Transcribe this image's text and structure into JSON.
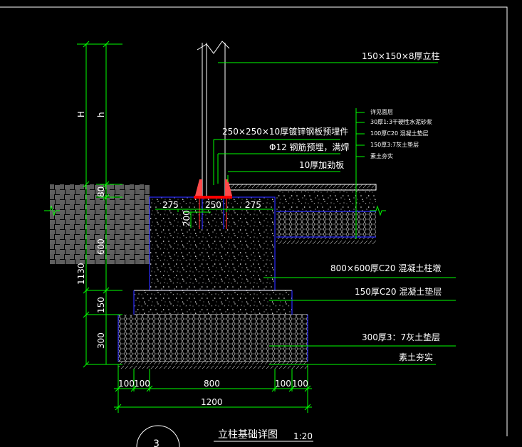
{
  "drawing": {
    "title": "立柱基础详图",
    "scale": "1:20",
    "detail_no": "3"
  },
  "callouts": {
    "post": "150×150×8厚立柱",
    "embed_plate": "250×250×10厚镀锌钢板预埋件",
    "rebar": "Φ12 钢筋预埋，满焊",
    "stiffener": "10厚加劲板",
    "pier": "800×600厚C20 混凝土柱墩",
    "c20_cushion": "150厚C20 混凝土垫层",
    "lime_soil": "300厚3：7灰土垫层",
    "subgrade": "素土夯实"
  },
  "paving_layers": [
    "详见面层",
    "30厚1:3干硬性水泥砂浆",
    "100厚C20 混凝土垫层",
    "150厚3:7灰土垫层",
    "素土夯实"
  ],
  "dimensions": {
    "overall_height": "H",
    "post_height": "h",
    "d80": "80",
    "d600": "600",
    "d1130": "1130",
    "d150": "150",
    "d300": "300",
    "d200": "200",
    "d275_left": "275",
    "d250": "250",
    "d275_right": "275",
    "b100_1": "100",
    "b100_2": "100",
    "b800": "800",
    "b100_3": "100",
    "b100_4": "100",
    "b1200": "1200"
  },
  "colors": {
    "dim_line": "#00ff00",
    "outline": "#ffffff",
    "concrete_edge": "#2b2bff",
    "embed_plate": "#ff0000",
    "background": "#000000"
  }
}
